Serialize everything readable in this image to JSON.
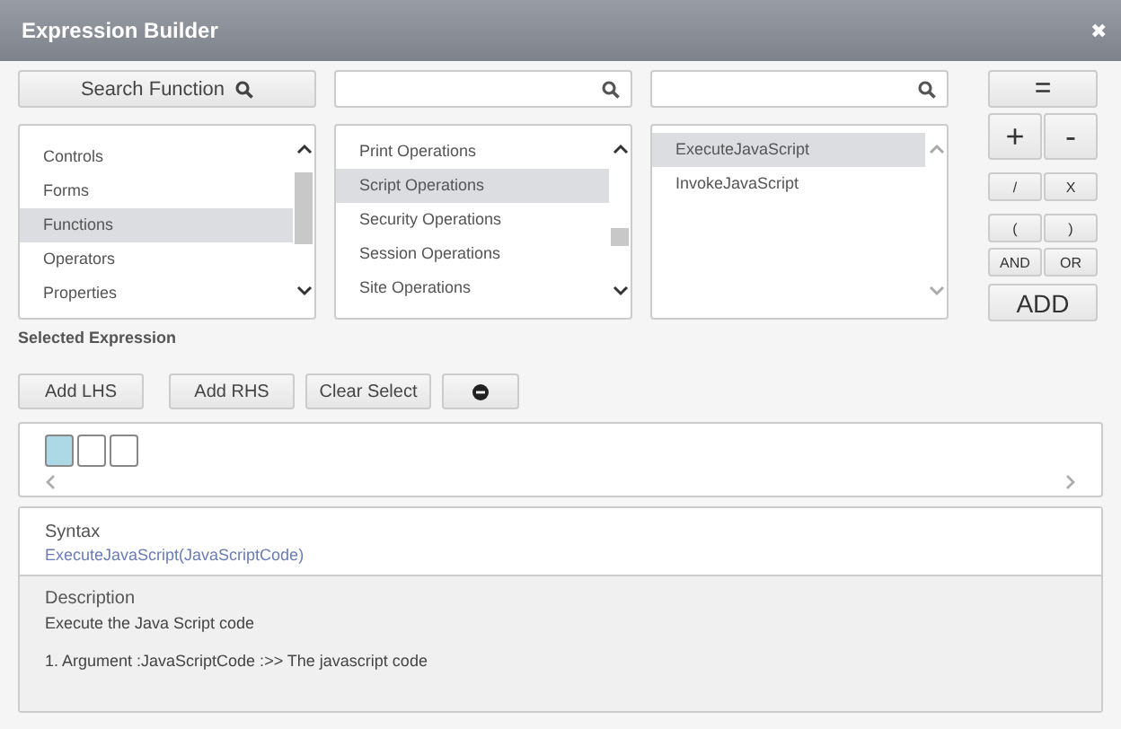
{
  "window": {
    "title": "Expression Builder",
    "close": "✖"
  },
  "search_button": {
    "label": "Search Function"
  },
  "search_fields": [
    {
      "kind": "search"
    },
    {
      "kind": "search"
    }
  ],
  "lists": [
    {
      "items": [
        {
          "label": "Controls",
          "selected": false
        },
        {
          "label": "Forms",
          "selected": false
        },
        {
          "label": "Functions",
          "selected": true
        },
        {
          "label": "Operators",
          "selected": false
        },
        {
          "label": "Properties",
          "selected": false
        }
      ]
    },
    {
      "items": [
        {
          "label": "Print Operations",
          "selected": false
        },
        {
          "label": "Script Operations",
          "selected": true
        },
        {
          "label": "Security Operations",
          "selected": false
        },
        {
          "label": "Session Operations",
          "selected": false
        },
        {
          "label": "Site Operations",
          "selected": false
        }
      ]
    },
    {
      "items": [
        {
          "label": "ExecuteJavaScript",
          "selected": true
        },
        {
          "label": "InvokeJavaScript",
          "selected": false
        }
      ]
    }
  ],
  "operators": [
    {
      "label": "=",
      "kind": "wide"
    },
    {
      "label": "+",
      "kind": "big"
    },
    {
      "label": "-",
      "kind": "big"
    },
    {
      "label": "/",
      "kind": "small"
    },
    {
      "label": "X",
      "kind": "small"
    },
    {
      "label": "(",
      "kind": "small"
    },
    {
      "label": ")",
      "kind": "small"
    },
    {
      "label": "AND",
      "kind": "small"
    },
    {
      "label": "OR",
      "kind": "small"
    },
    {
      "label": "ADD",
      "kind": "wide"
    }
  ],
  "selected_expression": {
    "label": "Selected Expression",
    "buttons": [
      {
        "label": "Add LHS",
        "kind": "text"
      },
      {
        "label": "Add RHS",
        "kind": "text"
      },
      {
        "label": "Clear Select",
        "kind": "text"
      },
      {
        "kind": "remove"
      }
    ],
    "slots": [
      {
        "selected": true
      },
      {
        "selected": false
      },
      {
        "selected": false
      }
    ]
  },
  "syntax": {
    "label": "Syntax",
    "value": "ExecuteJavaScript(JavaScriptCode)"
  },
  "description": {
    "label": "Description",
    "text": "Execute the Java Script code",
    "arguments": [
      "1. Argument :JavaScriptCode :>> The javascript code"
    ]
  }
}
